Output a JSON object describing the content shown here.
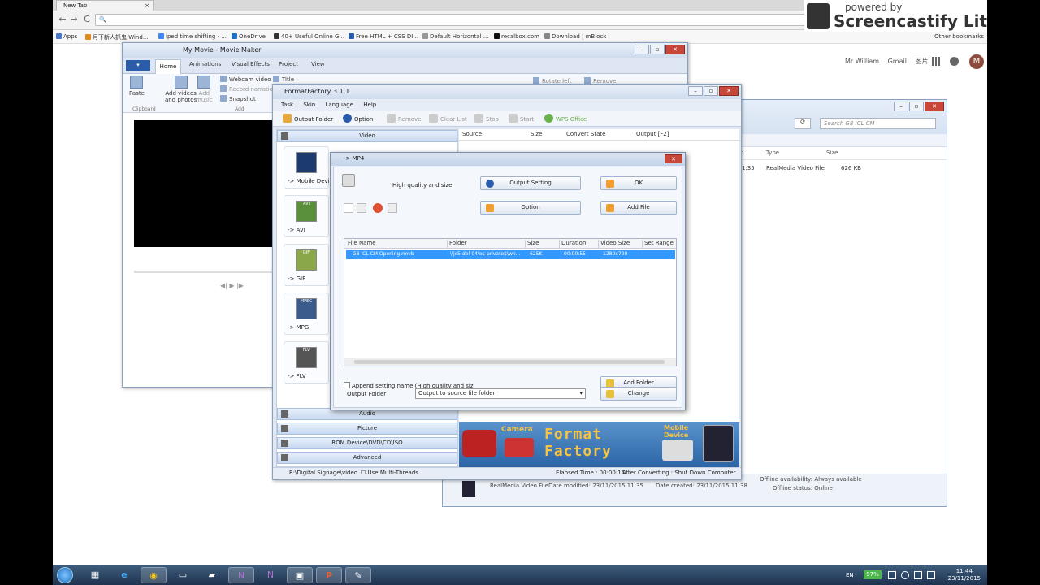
{
  "browser": {
    "tab_title": "New Tab",
    "tab_close": "×",
    "back": "←",
    "forward": "→",
    "reload": "C",
    "search_glyph": "🔍",
    "bookmarks": [
      {
        "label": "Apps",
        "color": "#4a78c8"
      },
      {
        "label": "月下新人抓鬼  Wind...",
        "color": "#e08a1e"
      },
      {
        "label": "iped time shifting - ...",
        "color": "#4285f4"
      },
      {
        "label": "OneDrive",
        "color": "#1e6fc1"
      },
      {
        "label": "40+ Useful Online G...",
        "color": "#333333"
      },
      {
        "label": "Free HTML + CSS DI...",
        "color": "#2a5caa"
      },
      {
        "label": "Default Horizontal ...",
        "color": "#999999"
      },
      {
        "label": "recalbox.com",
        "color": "#111111"
      },
      {
        "label": "Download | mBlock",
        "color": "#888888"
      }
    ],
    "other_bookmarks": "Other bookmarks",
    "google_links": {
      "user": "Mr William",
      "gmail": "Gmail",
      "images": "图片"
    },
    "avatar_letter": "M"
  },
  "watermark": {
    "powered": "powered by",
    "brand": "Screencastify Lite"
  },
  "movie_maker": {
    "title": "My Movie - Movie Maker",
    "tabs": [
      "Home",
      "Animations",
      "Visual Effects",
      "Project",
      "View"
    ],
    "paste": "Paste",
    "add_videos": "Add videos\nand photos",
    "add_music": "Add\nmusic",
    "webcam": "Webcam video",
    "record": "Record narration",
    "snapshot": "Snapshot",
    "title_btn": "Title",
    "rotate_left": "Rotate left",
    "remove": "Remove",
    "group_clipboard": "Clipboard",
    "group_add": "Add",
    "controls": "◀| ▶ |▶"
  },
  "explorer": {
    "search_placeholder": "Search G8 ICL CM",
    "cols": {
      "d": "d",
      "type": "Type",
      "size": "Size"
    },
    "row": {
      "time": "1:35",
      "type": "RealMedia Video File",
      "size": "626 KB"
    },
    "details": {
      "type": "RealMedia Video File",
      "modified": "Date modified: 23/11/2015 11:35",
      "created": "Date created: 23/11/2015 11:38",
      "offline_avail": "Offline availability: Always available",
      "offline_status": "Offline status: Online"
    }
  },
  "format_factory": {
    "title": "FormatFactory 3.1.1",
    "menu": [
      "Task",
      "Skin",
      "Language",
      "Help"
    ],
    "toolbar": {
      "output_folder": "Output Folder",
      "option": "Option",
      "remove": "Remove",
      "clear_list": "Clear List",
      "stop": "Stop",
      "start": "Start",
      "wps": "WPS Office"
    },
    "categories": {
      "video": "Video",
      "audio": "Audio",
      "picture": "Picture",
      "rom": "ROM Device\\DVD\\CD\\ISO",
      "advanced": "Advanced"
    },
    "formats": [
      "-> Mobile Device",
      "-> AVI",
      "-> GIF",
      "-> MPG",
      "-> FLV"
    ],
    "format_icons": [
      "",
      "AVI",
      "GIF",
      "MPEG",
      "FLV"
    ],
    "task_cols": {
      "source": "Source",
      "size": "Size",
      "convert_state": "Convert State",
      "output": "Output [F2]"
    },
    "banner": {
      "camera": "Camera",
      "title": "Format\nFactory",
      "mobile": "Mobile\nDevice"
    },
    "status": {
      "path": "R:\\Digital Signage\\video",
      "multithreads": "Use Multi-Threads",
      "elapsed": "Elapsed Time : 00:00:15",
      "after": "After Converting : Shut Down Computer"
    }
  },
  "mp4_dialog": {
    "title": "-> MP4",
    "quality": "High quality and size",
    "output_setting": "Output Setting",
    "ok": "OK",
    "option": "Option",
    "add_file": "Add File",
    "list_cols": [
      "File Name",
      "Folder",
      "Size",
      "Duration",
      "Video Size",
      "Set Range"
    ],
    "file": {
      "name": "G8 ICL CM Opening.rmvb",
      "folder": "\\\\jc5-del-04\\os-private$\\wn...",
      "size": "625K",
      "duration": "00:00:55",
      "video_size": "1280x720"
    },
    "append": "Append setting name (High quality and siz",
    "add_folder": "Add Folder",
    "output_folder_label": "Output Folder",
    "output_folder_value": "Output to source file folder",
    "change": "Change"
  },
  "taskbar": {
    "apps": [
      "▦",
      "e",
      "◉",
      "▭",
      "▰",
      "N",
      "N",
      "▣",
      "P",
      "✎"
    ],
    "lang": "EN",
    "battery": "97%",
    "time": "11:44",
    "date": "23/11/2015"
  }
}
